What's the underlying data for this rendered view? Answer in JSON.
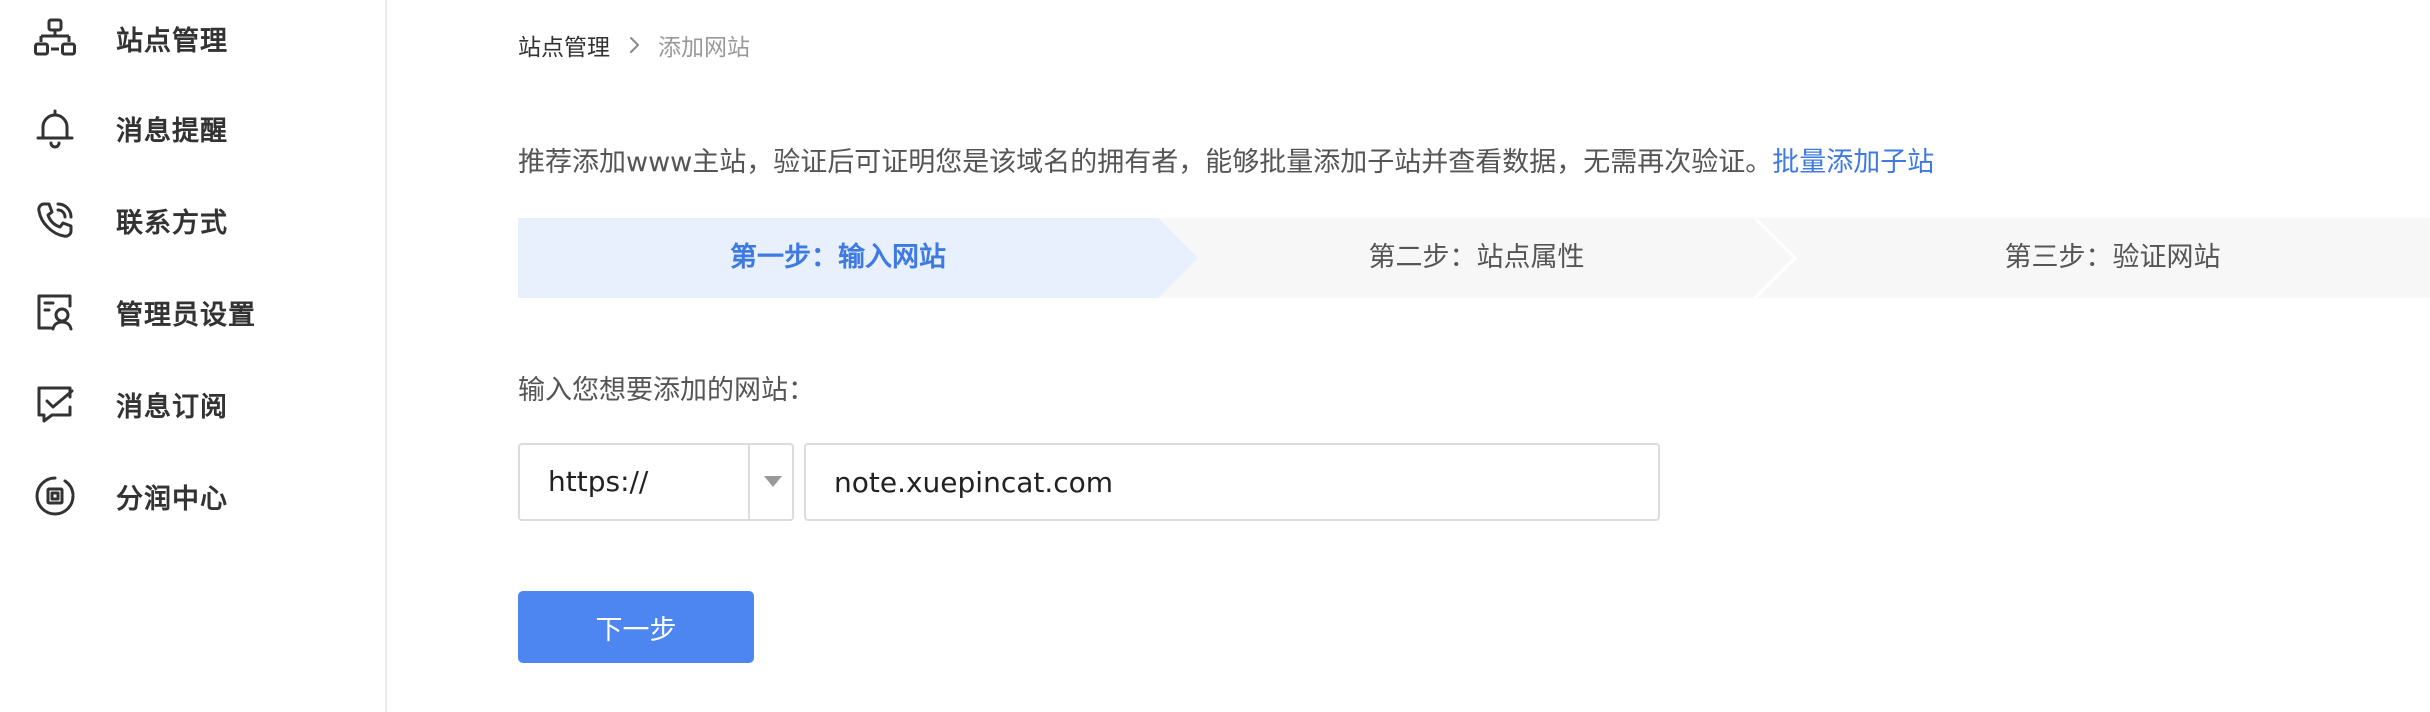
{
  "sidebar": {
    "items": [
      {
        "label": "站点管理",
        "icon": "sitemap-icon"
      },
      {
        "label": "消息提醒",
        "icon": "bell-icon"
      },
      {
        "label": "联系方式",
        "icon": "phone-icon"
      },
      {
        "label": "管理员设置",
        "icon": "admin-user-icon"
      },
      {
        "label": "消息订阅",
        "icon": "message-check-icon"
      },
      {
        "label": "分润中心",
        "icon": "coin-icon"
      }
    ]
  },
  "breadcrumb": {
    "parent": "站点管理",
    "current": "添加网站"
  },
  "intro": {
    "text": "推荐添加www主站，验证后可证明您是该域名的拥有者，能够批量添加子站并查看数据，无需再次验证。",
    "link": "批量添加子站"
  },
  "steps": [
    {
      "label": "第一步：输入网站",
      "state": "active"
    },
    {
      "label": "第二步：站点属性",
      "state": "pending"
    },
    {
      "label": "第三步：验证网站",
      "state": "pending"
    }
  ],
  "form": {
    "label": "输入您想要添加的网站：",
    "protocol": "https://",
    "url_value": "note.xuepincat.com"
  },
  "next_button": "下一步",
  "colors": {
    "accent": "#4d86f0",
    "link": "#3f7ae0",
    "active_step_bg": "#e8f0fd",
    "inactive_step_bg": "#f7f7f7"
  }
}
